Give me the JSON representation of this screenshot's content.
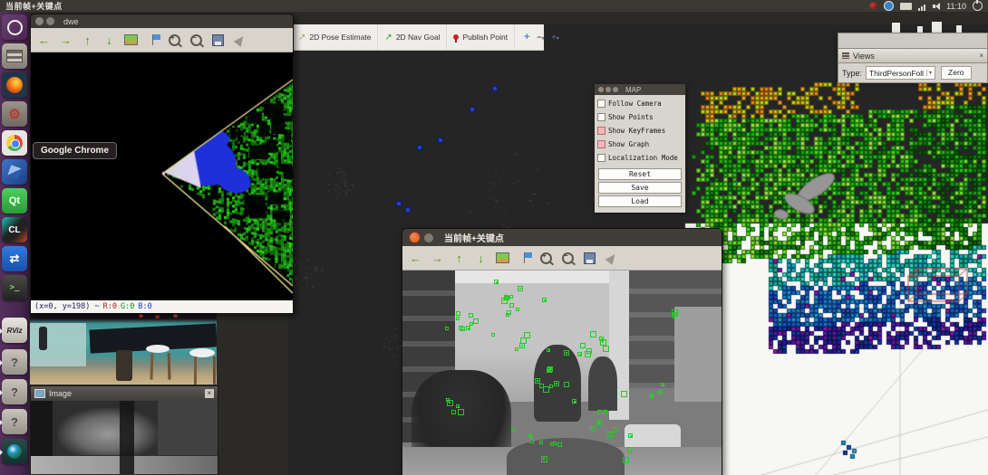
{
  "colors": {
    "ubuntu_orange": "#e05a2b",
    "keypoint_green": "#22cc22",
    "marker_blue": "#2644cc",
    "checked_pink": "#f4b6ba",
    "scan_yellow": "#ece48a",
    "scan_blue": "#2030d8",
    "viewport_dark": "#252525",
    "octomap_white": "#f7f7f5"
  },
  "top_bar": {
    "title": "当前帧+关键点",
    "clock": "11:10"
  },
  "launcher": {
    "items": [
      {
        "id": "dash",
        "glyph": ""
      },
      {
        "id": "files",
        "glyph": ""
      },
      {
        "id": "firefox",
        "glyph": ""
      },
      {
        "id": "system-settings",
        "glyph": ""
      },
      {
        "id": "chrome",
        "glyph": ""
      },
      {
        "id": "blue-app",
        "glyph": ""
      },
      {
        "id": "qt-creator",
        "glyph": "Qt"
      },
      {
        "id": "clion",
        "glyph": "CL"
      },
      {
        "id": "teamviewer",
        "glyph": ""
      },
      {
        "id": "terminal",
        "glyph": ">_"
      },
      {
        "id": "rviz",
        "glyph": "RViz"
      },
      {
        "id": "unknown-1",
        "glyph": "?"
      },
      {
        "id": "unknown-2",
        "glyph": "?"
      },
      {
        "id": "unknown-3",
        "glyph": "?"
      },
      {
        "id": "camera",
        "glyph": ""
      }
    ]
  },
  "tooltip": {
    "text": "Google Chrome"
  },
  "dwe_window": {
    "title": "dwe",
    "status": {
      "coords": "(x=0, y=198) ~",
      "r": "R:0",
      "g": "G:0",
      "b": "B:0"
    }
  },
  "keyframe_window": {
    "title": "当前帧+关键点"
  },
  "rviz": {
    "tools": [
      {
        "label": "2D Pose Estimate"
      },
      {
        "label": "2D Nav Goal"
      },
      {
        "label": "Publish Point"
      }
    ]
  },
  "map_panel": {
    "title": "MAP",
    "checkboxes": [
      {
        "label": "Follow Camera",
        "checked": false
      },
      {
        "label": "Show Points",
        "checked": false
      },
      {
        "label": "Show KeyFrames",
        "checked": true
      },
      {
        "label": "Show Graph",
        "checked": true
      },
      {
        "label": "Localization Mode",
        "checked": false
      }
    ],
    "buttons": [
      {
        "label": "Reset"
      },
      {
        "label": "Save"
      },
      {
        "label": "Load"
      }
    ]
  },
  "views_panel": {
    "title": "Views",
    "type_label": "Type:",
    "type_value": "ThirdPersonFoll",
    "zero": "Zero"
  },
  "image_panel": {
    "title": "Image"
  }
}
